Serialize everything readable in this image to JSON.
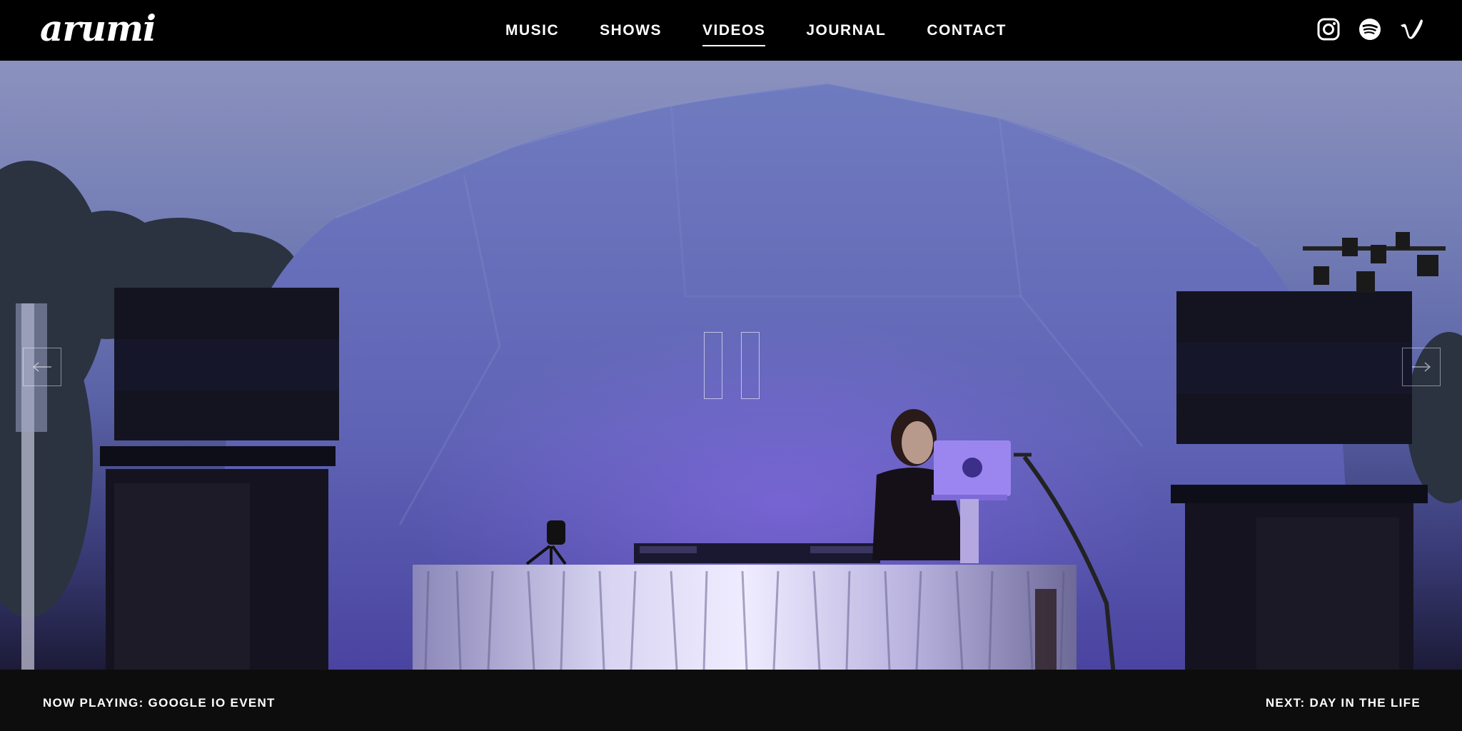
{
  "header": {
    "logo_text": "arumi",
    "nav": [
      {
        "label": "MUSIC",
        "active": false
      },
      {
        "label": "SHOWS",
        "active": false
      },
      {
        "label": "VIDEOS",
        "active": true
      },
      {
        "label": "JOURNAL",
        "active": false
      },
      {
        "label": "CONTACT",
        "active": false
      }
    ],
    "social": [
      {
        "icon": "instagram-icon"
      },
      {
        "icon": "spotify-icon"
      },
      {
        "icon": "vimeo-icon"
      }
    ]
  },
  "player": {
    "state": "playing",
    "control_icon": "pause-icon",
    "prev_icon": "arrow-left-icon",
    "next_icon": "arrow-right-icon"
  },
  "footer": {
    "now_playing": "NOW PLAYING: GOOGLE IO EVENT",
    "next": "NEXT: DAY IN THE LIFE"
  },
  "colors": {
    "header_bg": "#000000",
    "footer_bg": "#0d0d0d",
    "text": "#ffffff",
    "sky": "#8c92be",
    "dome": "#6f79bd"
  }
}
